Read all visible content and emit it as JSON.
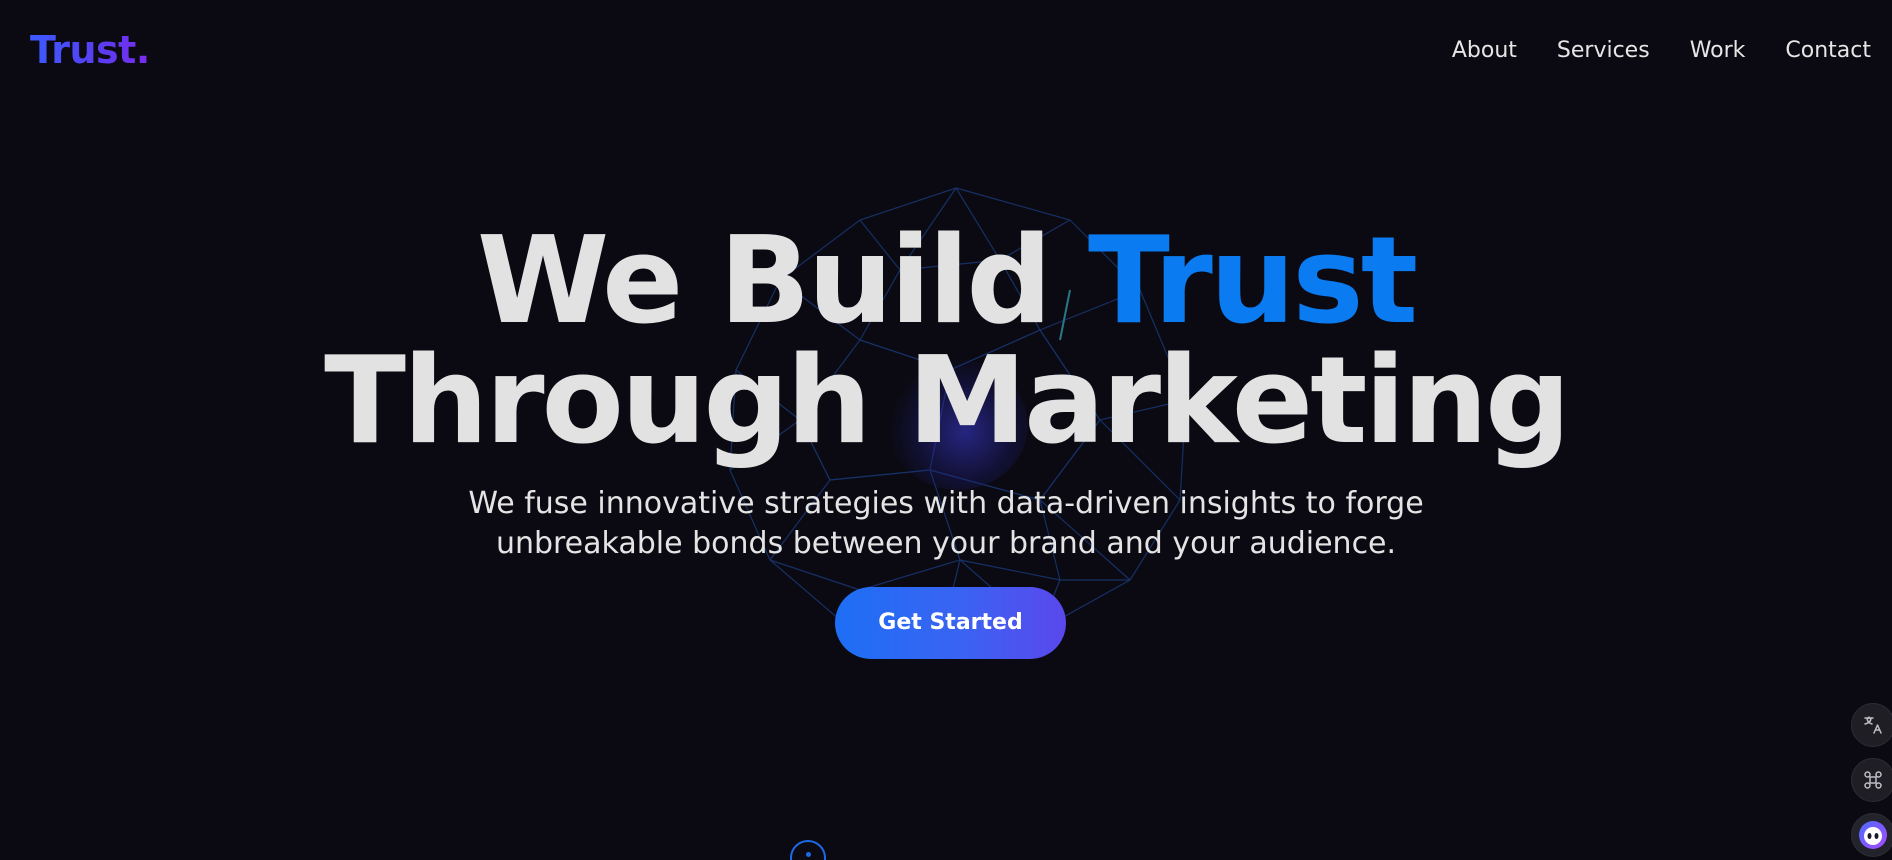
{
  "header": {
    "logo_text": "Trust."
  },
  "nav": {
    "items": [
      {
        "label": "About"
      },
      {
        "label": "Services"
      },
      {
        "label": "Work"
      },
      {
        "label": "Contact"
      }
    ]
  },
  "hero": {
    "title_part1": "We Build ",
    "title_accent": "Trust",
    "title_line2": "Through Marketing",
    "subtitle_line1": "We fuse innovative strategies with data-driven insights to forge",
    "subtitle_line2": "unbreakable bonds between your brand and your audience.",
    "cta_label": "Get Started"
  },
  "floating_buttons": [
    {
      "icon": "translate-icon"
    },
    {
      "icon": "command-icon"
    },
    {
      "icon": "assistant-avatar-icon"
    }
  ],
  "colors": {
    "background": "#0b0a12",
    "accent": "#0a7bf0",
    "logo_gradient_start": "#3b5bff",
    "logo_gradient_end": "#7a2bf0",
    "cta_gradient_start": "#1d6ff5",
    "cta_gradient_end": "#5a48ec",
    "text": "#e2e2e2"
  }
}
